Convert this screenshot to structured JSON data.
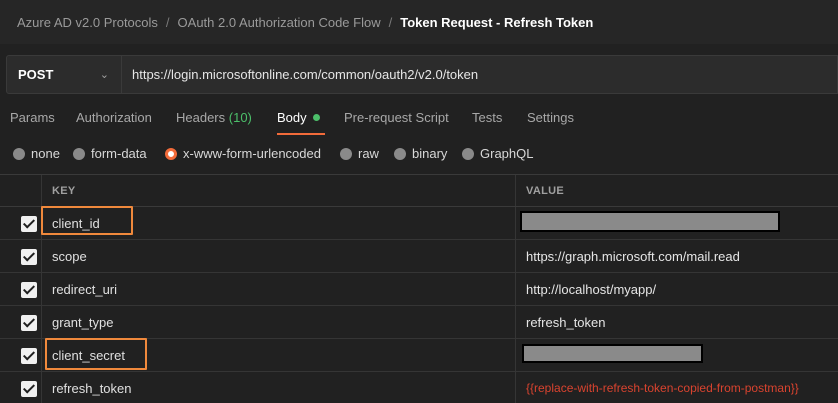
{
  "breadcrumb": {
    "items": [
      "Azure AD v2.0 Protocols",
      "OAuth 2.0 Authorization Code Flow"
    ],
    "current": "Token Request - Refresh Token",
    "separator": "/"
  },
  "request": {
    "method": "POST",
    "url": "https://login.microsoftonline.com/common/oauth2/v2.0/token"
  },
  "tabs": {
    "params": "Params",
    "authorization": "Authorization",
    "headers": "Headers",
    "headers_count": "(10)",
    "body": "Body",
    "prerequest": "Pre-request Script",
    "tests": "Tests",
    "settings": "Settings",
    "active": "Body"
  },
  "body_types": {
    "none": "none",
    "form_data": "form-data",
    "urlencoded": "x-www-form-urlencoded",
    "raw": "raw",
    "binary": "binary",
    "graphql": "GraphQL",
    "selected": "x-www-form-urlencoded"
  },
  "table": {
    "key_header": "KEY",
    "value_header": "VALUE",
    "rows": [
      {
        "key": "client_id",
        "value": "",
        "checked": true,
        "redacted": true
      },
      {
        "key": "scope",
        "value": "https://graph.microsoft.com/mail.read",
        "checked": true
      },
      {
        "key": "redirect_uri",
        "value": "http://localhost/myapp/",
        "checked": true
      },
      {
        "key": "grant_type",
        "value": "refresh_token",
        "checked": true
      },
      {
        "key": "client_secret",
        "value": "",
        "checked": true,
        "redacted": true
      },
      {
        "key": "refresh_token",
        "value": "{{replace-with-refresh-token-copied-from-postman}}",
        "checked": true
      }
    ]
  },
  "colors": {
    "accent": "#f26b3a",
    "highlight": "#f0893c",
    "success": "#4cbf6a",
    "variable": "#d9432f"
  }
}
